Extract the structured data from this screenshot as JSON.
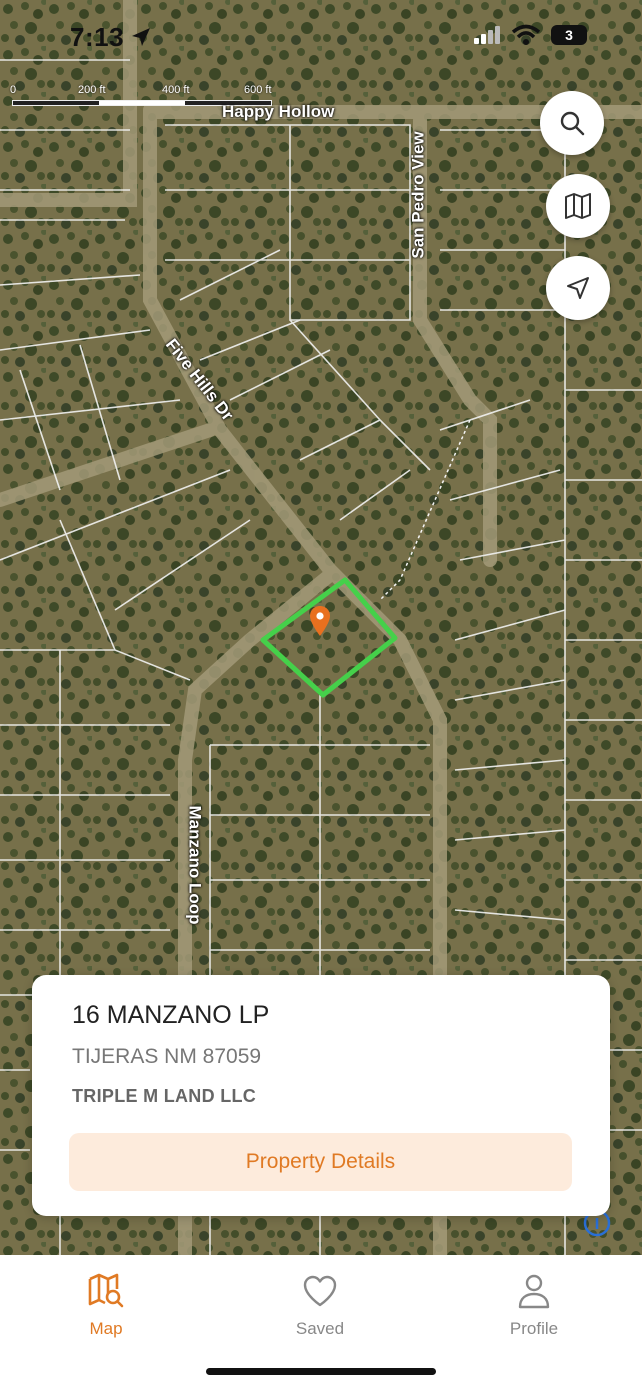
{
  "status_bar": {
    "time": "7:13",
    "battery": "3"
  },
  "map": {
    "scale_labels": [
      "0",
      "200 ft",
      "400 ft",
      "600 ft"
    ],
    "road_labels": {
      "happy_hollow": "Happy Hollow",
      "san_pedro_view": "San Pedro View",
      "five_hills_dr": "Five Hills Dr",
      "manzano_loop": "Manzano Loop"
    },
    "parcel_outline_color": "#45d04a",
    "pin_color": "#e8701f",
    "buttons": {
      "search": "search-icon",
      "map_layers": "map-icon",
      "locate": "navigation-arrow-icon"
    }
  },
  "property_card": {
    "address": "16 MANZANO LP",
    "city_state_zip": "TIJERAS NM 87059",
    "owner": "TRIPLE M LAND LLC",
    "details_button": "Property Details"
  },
  "tab_bar": {
    "accent_color": "#e07a24",
    "tabs": [
      {
        "label": "Map",
        "icon": "map-search-icon",
        "active": true
      },
      {
        "label": "Saved",
        "icon": "heart-icon",
        "active": false
      },
      {
        "label": "Profile",
        "icon": "person-icon",
        "active": false
      }
    ]
  }
}
